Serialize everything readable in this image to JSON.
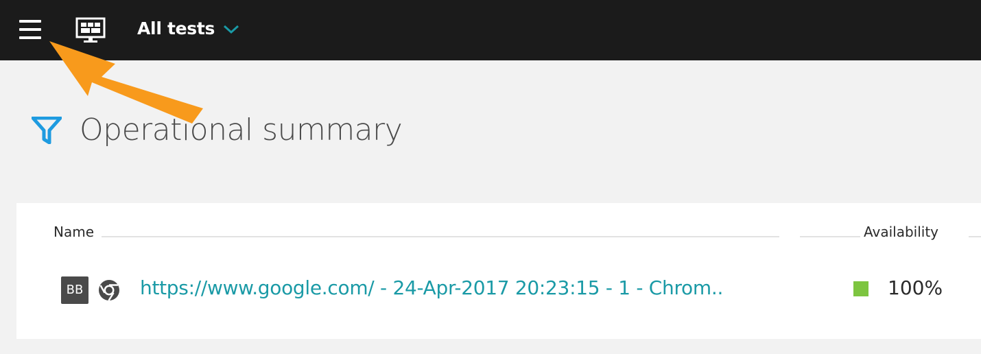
{
  "header": {
    "title": "All tests",
    "icons": {
      "menu": "hamburger-menu-icon",
      "dashboard": "monitor-icon",
      "dropdown": "chevron-down-icon"
    },
    "accent_color": "#1a9aa6"
  },
  "page": {
    "title": "Operational summary",
    "filter_icon": "filter-icon",
    "filter_color": "#1e9be0"
  },
  "table": {
    "columns": [
      "Name",
      "Availability"
    ],
    "rows": [
      {
        "badge": "BB",
        "browser_icon": "chrome-icon",
        "name": "https://www.google.com/ - 24-Apr-2017 20:23:15 - 1 - Chrom..",
        "status_color": "#7dc540",
        "availability": "100%"
      }
    ]
  },
  "annotation": {
    "type": "arrow",
    "color": "#f89a1c"
  }
}
